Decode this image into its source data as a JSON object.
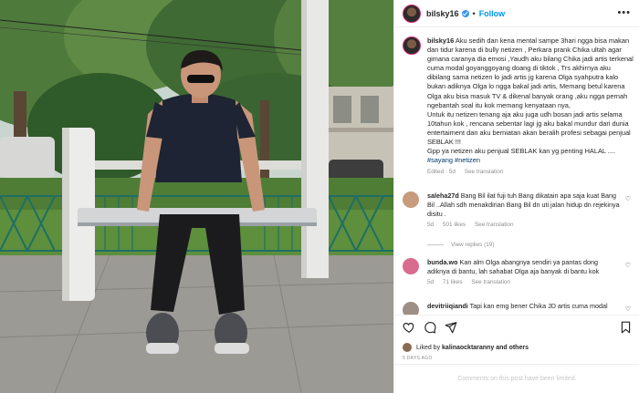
{
  "post": {
    "username": "bilsky16",
    "follow_label": "Follow",
    "separator": "•",
    "more_label": "•••"
  },
  "caption": {
    "username": "bilsky16",
    "text": "Aku sedih dan kena mental sampe 3hari ngga bisa makan dan tidur karena di bully netizen , Perkara prank Chika ultah agar gimana caranya dia emosi ,Yaudh aku bilang Chika jadi artis terkenal cuma modal goyanggoyang doang di tiktok , Trs akhirnya aku dibilang sama netizen lo jadi artis jg karena Olga syahputra kalo bukan adiknya Olga lo ngga bakal jadi artis, Memang betul karena Olga aku bisa masuk TV & dikenal banyak orang ,aku ngga pernah ngebantah soal itu kok memang kenyataan nya,",
    "text2": "Untuk itu netizen tenang aja aku jugа udh bosan jadi artis selama 10tahun kok , rencana sebentar lagi jg aku bakal mundur dari dunia entertaiment dan aku berniatan akan beralih profesi sebagai penjual SEBLAK !!!",
    "text3": "Gpp ya netizen aku penjual SEBLAK kan yg penting HALAL ....",
    "hashtags": "#sayang #netizen",
    "edited": "Edited · 5d",
    "see_translation": "See translation"
  },
  "comments": [
    {
      "username": "saleha27d",
      "text": "Bang Bil ilat fuji tuh Bang dikatain apa saja kuat Bang Bil ..Allah sdh menakdirian Bang Bil dn uti jalan hidup dn rejekinya disitu .",
      "time": "5d",
      "likes": "501 likes",
      "see_translation": "See translation",
      "view_replies": "View replies (19)",
      "avatar_color": "#c79b7e"
    },
    {
      "username": "bunda.wo",
      "text": "Kan alm Olga abangnya sendiri ya pantas dong adiknya di bantu, lah sahabat Olga aja banyak di bantu kok",
      "time": "5d",
      "likes": "71 likes",
      "see_translation": "See translation",
      "avatar_color": "#d96b8f"
    },
    {
      "username": "devitriiqiandi",
      "text": "Tapi kan emg bener Chika JD artis cuma modal",
      "avatar_color": "#9e8f86"
    }
  ],
  "actions": {
    "liked_by_prefix": "Liked by",
    "liked_by_user": "kalinaocktaranny",
    "liked_by_suffix": "and others",
    "date": "5 DAYS AGO"
  },
  "footer": {
    "limited_text": "Comments on this post have been limited."
  },
  "icons": [
    "heart-icon",
    "comment-icon",
    "share-icon",
    "bookmark-icon",
    "verified-icon",
    "more-icon"
  ],
  "colors": {
    "accent": "#0095f6",
    "verified": "#3897f0",
    "hashtag": "#00376b",
    "secondary_text": "#8e8e8e"
  }
}
